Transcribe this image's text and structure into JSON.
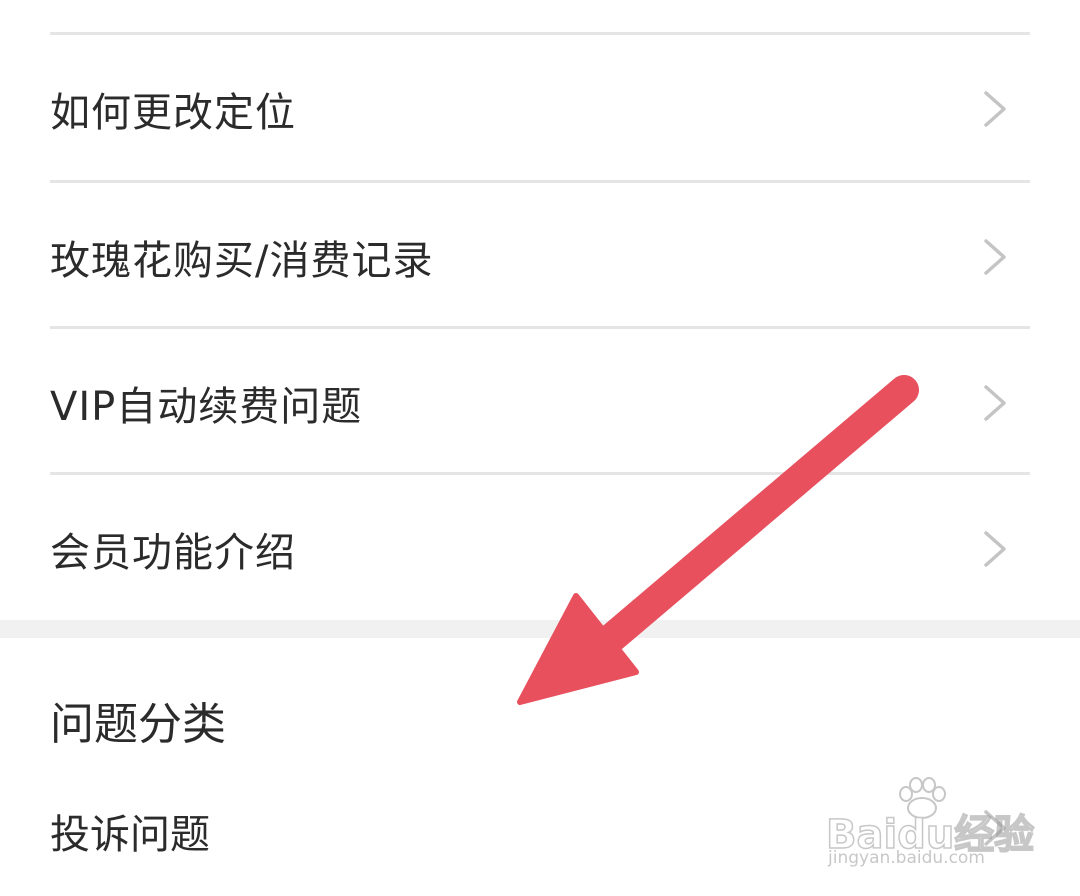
{
  "menu": {
    "items": [
      {
        "label": "如何更改定位",
        "icon": "chevron-right-icon"
      },
      {
        "label": "玫瑰花购买/消费记录",
        "icon": "chevron-right-icon"
      },
      {
        "label": "VIP自动续费问题",
        "icon": "chevron-right-icon"
      },
      {
        "label": "会员功能介绍",
        "icon": "chevron-right-icon"
      }
    ]
  },
  "section": {
    "title": "问题分类",
    "items": [
      {
        "label": "投诉问题",
        "icon": "chevron-right-icon"
      }
    ]
  },
  "annotation": {
    "icon": "red-arrow-annotation",
    "color": "#e8505e"
  },
  "watermark": {
    "brand": "Baidu经验",
    "url": "jingyan.baidu.com",
    "icon": "baidu-paw-icon"
  },
  "colors": {
    "divider": "#e5e5e5",
    "section_gap": "#f1f1f1",
    "text": "#2b2b2b",
    "chevron": "#c4c4c4"
  }
}
